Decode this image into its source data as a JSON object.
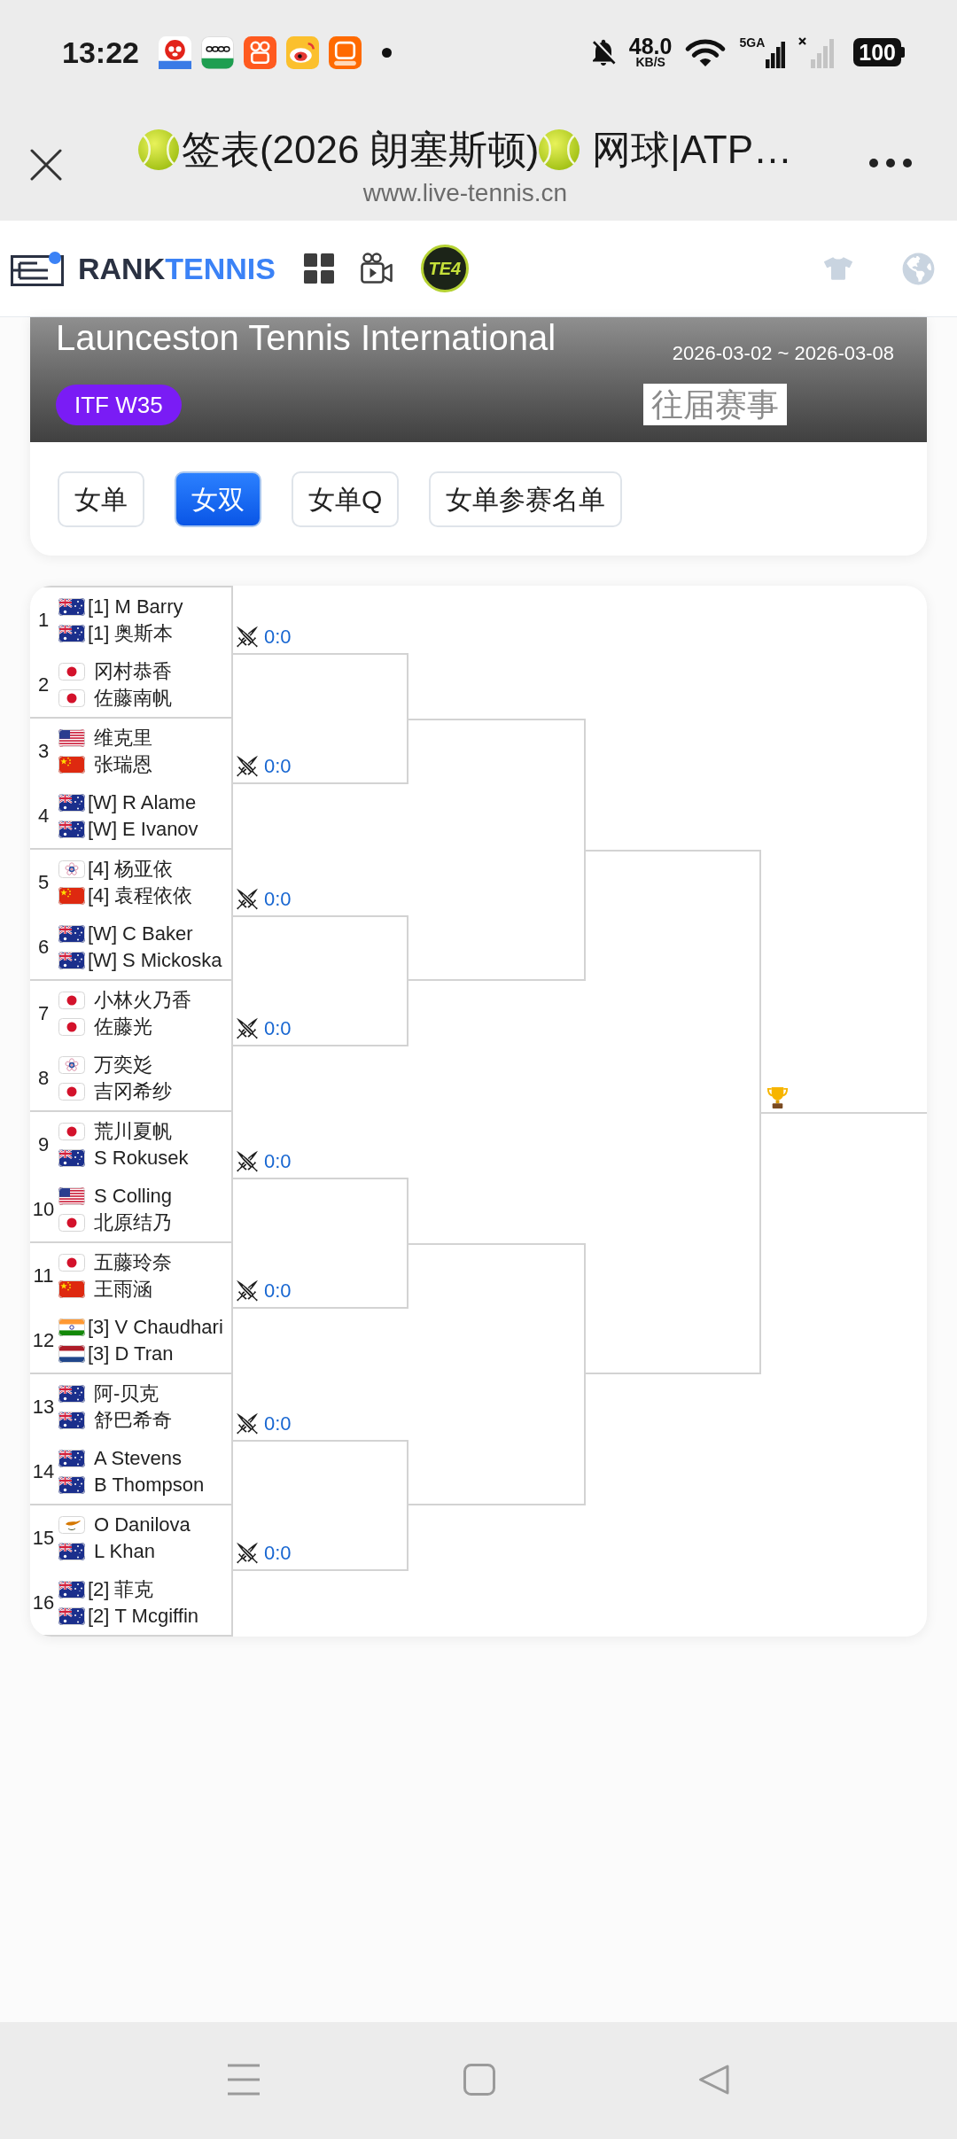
{
  "status_bar": {
    "time": "13:22",
    "speed_value": "48.0",
    "speed_unit": "KB/S",
    "network_type": "5GA",
    "battery": "100"
  },
  "browser_bar": {
    "title_parts": [
      "签表(2026 朗塞斯顿)",
      "网球|ATP…"
    ],
    "url": "www.live-tennis.cn"
  },
  "site_header": {
    "logo_parts": [
      "RANK",
      "TENNIS"
    ],
    "badge": "TE4"
  },
  "tournament": {
    "name": "Launceston Tennis International",
    "dates": "2026-03-02 ~ 2026-03-08",
    "category": "ITF W35",
    "history_link": "往届赛事"
  },
  "tabs": [
    {
      "label": "女单",
      "selected": false
    },
    {
      "label": "女双",
      "selected": true
    },
    {
      "label": "女单Q",
      "selected": false
    },
    {
      "label": "女单参赛名单",
      "selected": false
    }
  ],
  "draw": {
    "entries": [
      {
        "number": "1",
        "players": [
          {
            "kind": "aus",
            "seed": "[1]",
            "name": "M Barry"
          },
          {
            "kind": "aus",
            "seed": "[1]",
            "name": "奥斯本"
          }
        ]
      },
      {
        "number": "2",
        "players": [
          {
            "kind": "jpn",
            "name": "冈村恭香"
          },
          {
            "kind": "jpn",
            "name": "佐藤南帆"
          }
        ]
      },
      {
        "number": "3",
        "players": [
          {
            "kind": "usa",
            "name": "维克里"
          },
          {
            "kind": "chn",
            "name": "张瑞恩"
          }
        ]
      },
      {
        "number": "4",
        "players": [
          {
            "kind": "aus",
            "seed": "[W]",
            "name": "R Alame"
          },
          {
            "kind": "aus",
            "seed": "[W]",
            "name": "E Ivanov"
          }
        ]
      },
      {
        "number": "5",
        "players": [
          {
            "kind": "tpe",
            "seed": "[4]",
            "name": "杨亚依"
          },
          {
            "kind": "chn",
            "seed": "[4]",
            "name": "袁程依依"
          }
        ]
      },
      {
        "number": "6",
        "players": [
          {
            "kind": "aus",
            "seed": "[W]",
            "name": "C Baker"
          },
          {
            "kind": "aus",
            "seed": "[W]",
            "name": "S Mickoska"
          }
        ]
      },
      {
        "number": "7",
        "players": [
          {
            "kind": "jpn",
            "name": "小林火乃香"
          },
          {
            "kind": "jpn",
            "name": "佐藤光"
          }
        ]
      },
      {
        "number": "8",
        "players": [
          {
            "kind": "tpe",
            "name": "万奕彣"
          },
          {
            "kind": "jpn",
            "name": "吉冈希纱"
          }
        ]
      },
      {
        "number": "9",
        "players": [
          {
            "kind": "jpn",
            "name": "荒川夏帆"
          },
          {
            "kind": "aus",
            "name": "S Rokusek"
          }
        ]
      },
      {
        "number": "10",
        "players": [
          {
            "kind": "usa",
            "name": "S Colling"
          },
          {
            "kind": "jpn",
            "name": "北原结乃"
          }
        ]
      },
      {
        "number": "11",
        "players": [
          {
            "kind": "jpn",
            "name": "五藤玲奈"
          },
          {
            "kind": "chn",
            "name": "王雨涵"
          }
        ]
      },
      {
        "number": "12",
        "players": [
          {
            "kind": "ind",
            "seed": "[3]",
            "name": "V Chaudhari"
          },
          {
            "kind": "ned",
            "seed": "[3]",
            "name": "D Tran"
          }
        ]
      },
      {
        "number": "13",
        "players": [
          {
            "kind": "aus",
            "name": "阿-贝克"
          },
          {
            "kind": "aus",
            "name": "舒巴希奇"
          }
        ]
      },
      {
        "number": "14",
        "players": [
          {
            "kind": "aus",
            "name": "A Stevens"
          },
          {
            "kind": "aus",
            "name": "B Thompson"
          }
        ]
      },
      {
        "number": "15",
        "players": [
          {
            "kind": "cyp",
            "name": "O Danilova"
          },
          {
            "kind": "aus",
            "name": "L Khan"
          }
        ]
      },
      {
        "number": "16",
        "players": [
          {
            "kind": "aus",
            "seed": "[2]",
            "name": "菲克"
          },
          {
            "kind": "aus",
            "seed": "[2]",
            "name": "T Mcgiffin"
          }
        ]
      }
    ],
    "first_round": [
      {
        "score": "0:0"
      },
      {
        "score": "0:0"
      },
      {
        "score": "0:0"
      },
      {
        "score": "0:0"
      },
      {
        "score": "0:0"
      },
      {
        "score": "0:0"
      },
      {
        "score": "0:0"
      },
      {
        "score": "0:0"
      }
    ]
  }
}
